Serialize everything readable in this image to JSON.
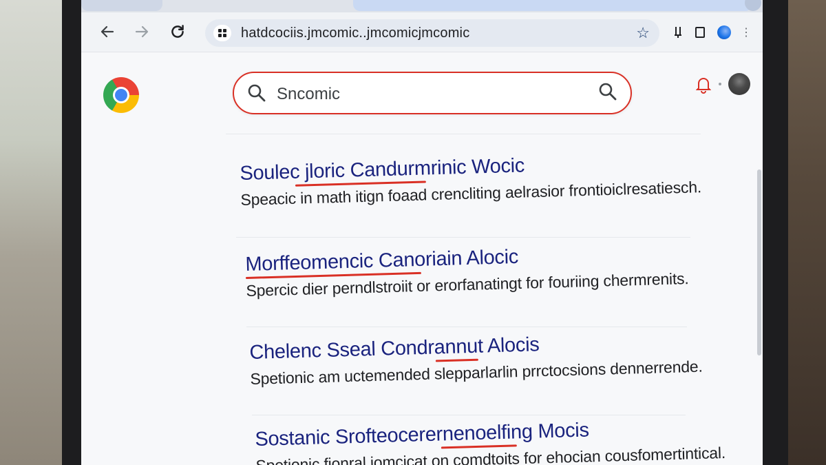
{
  "browser": {
    "url": "hatdcociis.jmcomic..jmcomicjmcomic",
    "colors": {
      "accent_red": "#d93025",
      "title_blue": "#1a237e",
      "toolbar": "#f1f3f6"
    },
    "icons": {
      "back": "back-arrow-icon",
      "forward": "forward-arrow-icon",
      "reload": "reload-icon",
      "site_info": "site-info-icon",
      "bookmark": "star-icon"
    }
  },
  "page": {
    "search": {
      "query": "Sncomic"
    },
    "results": [
      {
        "title": "Soulec jloric Candurmrinic Wocic",
        "snippet": "Speacic in math itign foaad crencliting aelrasior frontioiclresatiesch."
      },
      {
        "title": "Morffeomencic Canoriain Alocic",
        "snippet": "Spercic dier perndlstroiit or erorfanatingt for fouriing chermrenits."
      },
      {
        "title": "Chelenc Sseal Condrannut Alocis",
        "snippet": "Spetionic am uctemended slepparlarlin prrctocsions dennerrende."
      },
      {
        "title": "Sostanic Srofteocerernenoelfing Mocis",
        "snippet": "Spetionic fionral jomcicat on comdtoits for ehocian cousfomertintical."
      }
    ]
  }
}
